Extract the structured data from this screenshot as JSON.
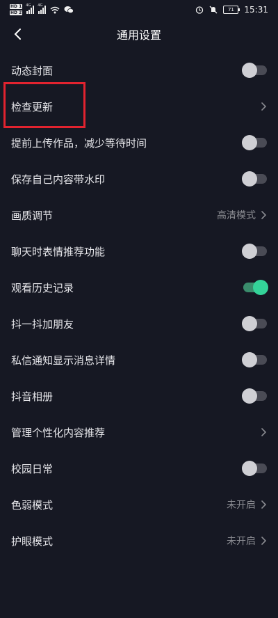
{
  "status_bar": {
    "hd1": "HD 1",
    "hd2": "HD 2",
    "net1": "4G",
    "net2": "4G",
    "battery": "71",
    "time": "15:31"
  },
  "header": {
    "title": "通用设置"
  },
  "items": [
    {
      "label": "动态封面",
      "type": "toggle",
      "on": false
    },
    {
      "label": "检查更新",
      "type": "link"
    },
    {
      "label": "提前上传作品，减少等待时间",
      "type": "toggle",
      "on": false
    },
    {
      "label": "保存自己内容带水印",
      "type": "toggle",
      "on": false
    },
    {
      "label": "画质调节",
      "type": "link",
      "value": "高清模式"
    },
    {
      "label": "聊天时表情推荐功能",
      "type": "toggle",
      "on": false
    },
    {
      "label": "观看历史记录",
      "type": "toggle",
      "on": true
    },
    {
      "label": "抖一抖加朋友",
      "type": "toggle",
      "on": false
    },
    {
      "label": "私信通知显示消息详情",
      "type": "toggle",
      "on": false
    },
    {
      "label": "抖音相册",
      "type": "toggle",
      "on": false
    },
    {
      "label": "管理个性化内容推荐",
      "type": "link"
    },
    {
      "label": "校园日常",
      "type": "toggle",
      "on": false
    },
    {
      "label": "色弱模式",
      "type": "link",
      "value": "未开启"
    },
    {
      "label": "护眼模式",
      "type": "link",
      "value": "未开启"
    }
  ],
  "colors": {
    "background": "#161823",
    "toggle_on": "#34d399",
    "highlight": "#e2232f"
  }
}
